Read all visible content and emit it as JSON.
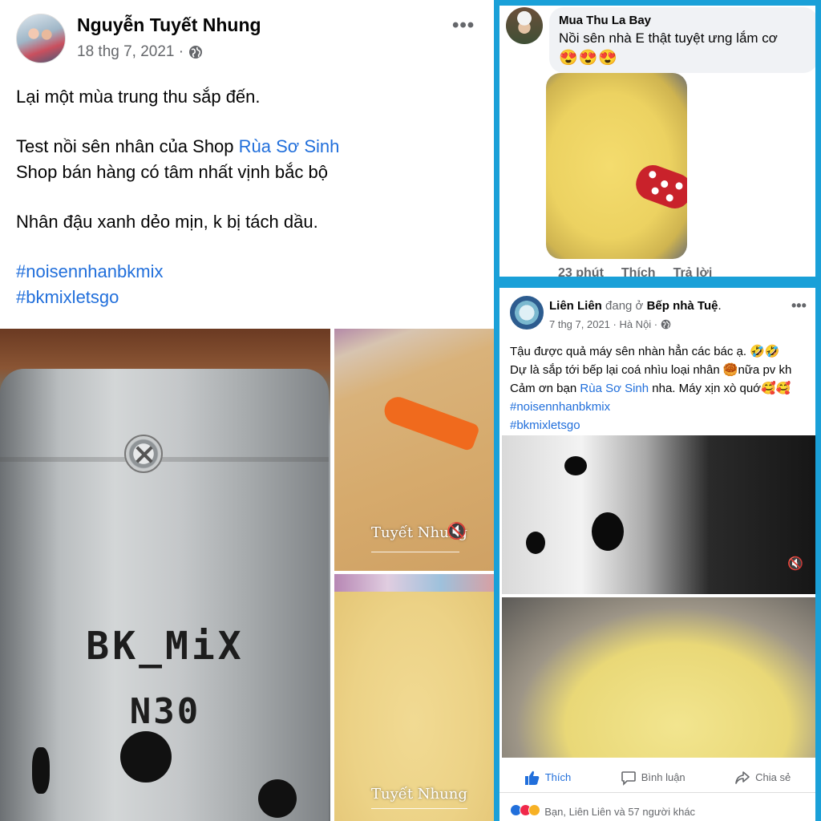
{
  "left_post": {
    "author": "Nguyễn Tuyết Nhung",
    "date": "18 thg 7, 2021 ·",
    "more_label": "•••",
    "lines": {
      "l1": "Lại một mùa trung thu sắp đến.",
      "l2_prefix": "Test nồi sên nhân của Shop ",
      "l2_link": "Rùa Sơ Sinh",
      "l3": "Shop bán hàng có tâm nhất vịnh bắc bộ",
      "l4": "Nhân đậu xanh dẻo mịn, k bị tách dầu.",
      "tag1": "#noisennhanbkmix",
      "tag2": "#bkmixletsgo"
    },
    "photo_text": {
      "line1": "BK_MiX",
      "line2": "N30"
    },
    "watermark": "Tuyết Nhung",
    "mute_icon": "🔇"
  },
  "comment": {
    "name": "Mua Thu La Bay",
    "text": "Nồi sên nhà E thật tuyệt ưng lắm cơ",
    "emojis": "😍😍😍",
    "time": "23 phút",
    "like": "Thích",
    "reply": "Trả lời"
  },
  "right_post": {
    "author": "Liên Liên",
    "at": " đang ở ",
    "place": "Bếp nhà Tuệ",
    "period": ".",
    "date": "7 thg 7, 2021 · Hà Nội ·",
    "more_label": "•••",
    "line1": "Tậu được quả máy sên nhàn hẳn các bác ạ. 🤣🤣",
    "line2": "Dự là sắp tới bếp lại coá nhìu loại nhân 🥮nữa pv kh",
    "line3_prefix": "Cảm ơn bạn ",
    "line3_link": "Rùa Sơ Sinh",
    "line3_suffix": " nha. Máy xịn xò quớ🥰🥰",
    "tag1": "#noisennhanbkmix",
    "tag2": "#bkmixletsgo",
    "like": "Thích",
    "comment": "Bình luận",
    "share": "Chia sẻ",
    "reactions_text": "Bạn, Liên Liên và 57 người khác",
    "mute_icon": "🔇"
  },
  "colors": {
    "link": "#216fdb",
    "frame": "#1aa0d8",
    "meta": "#65676b"
  }
}
